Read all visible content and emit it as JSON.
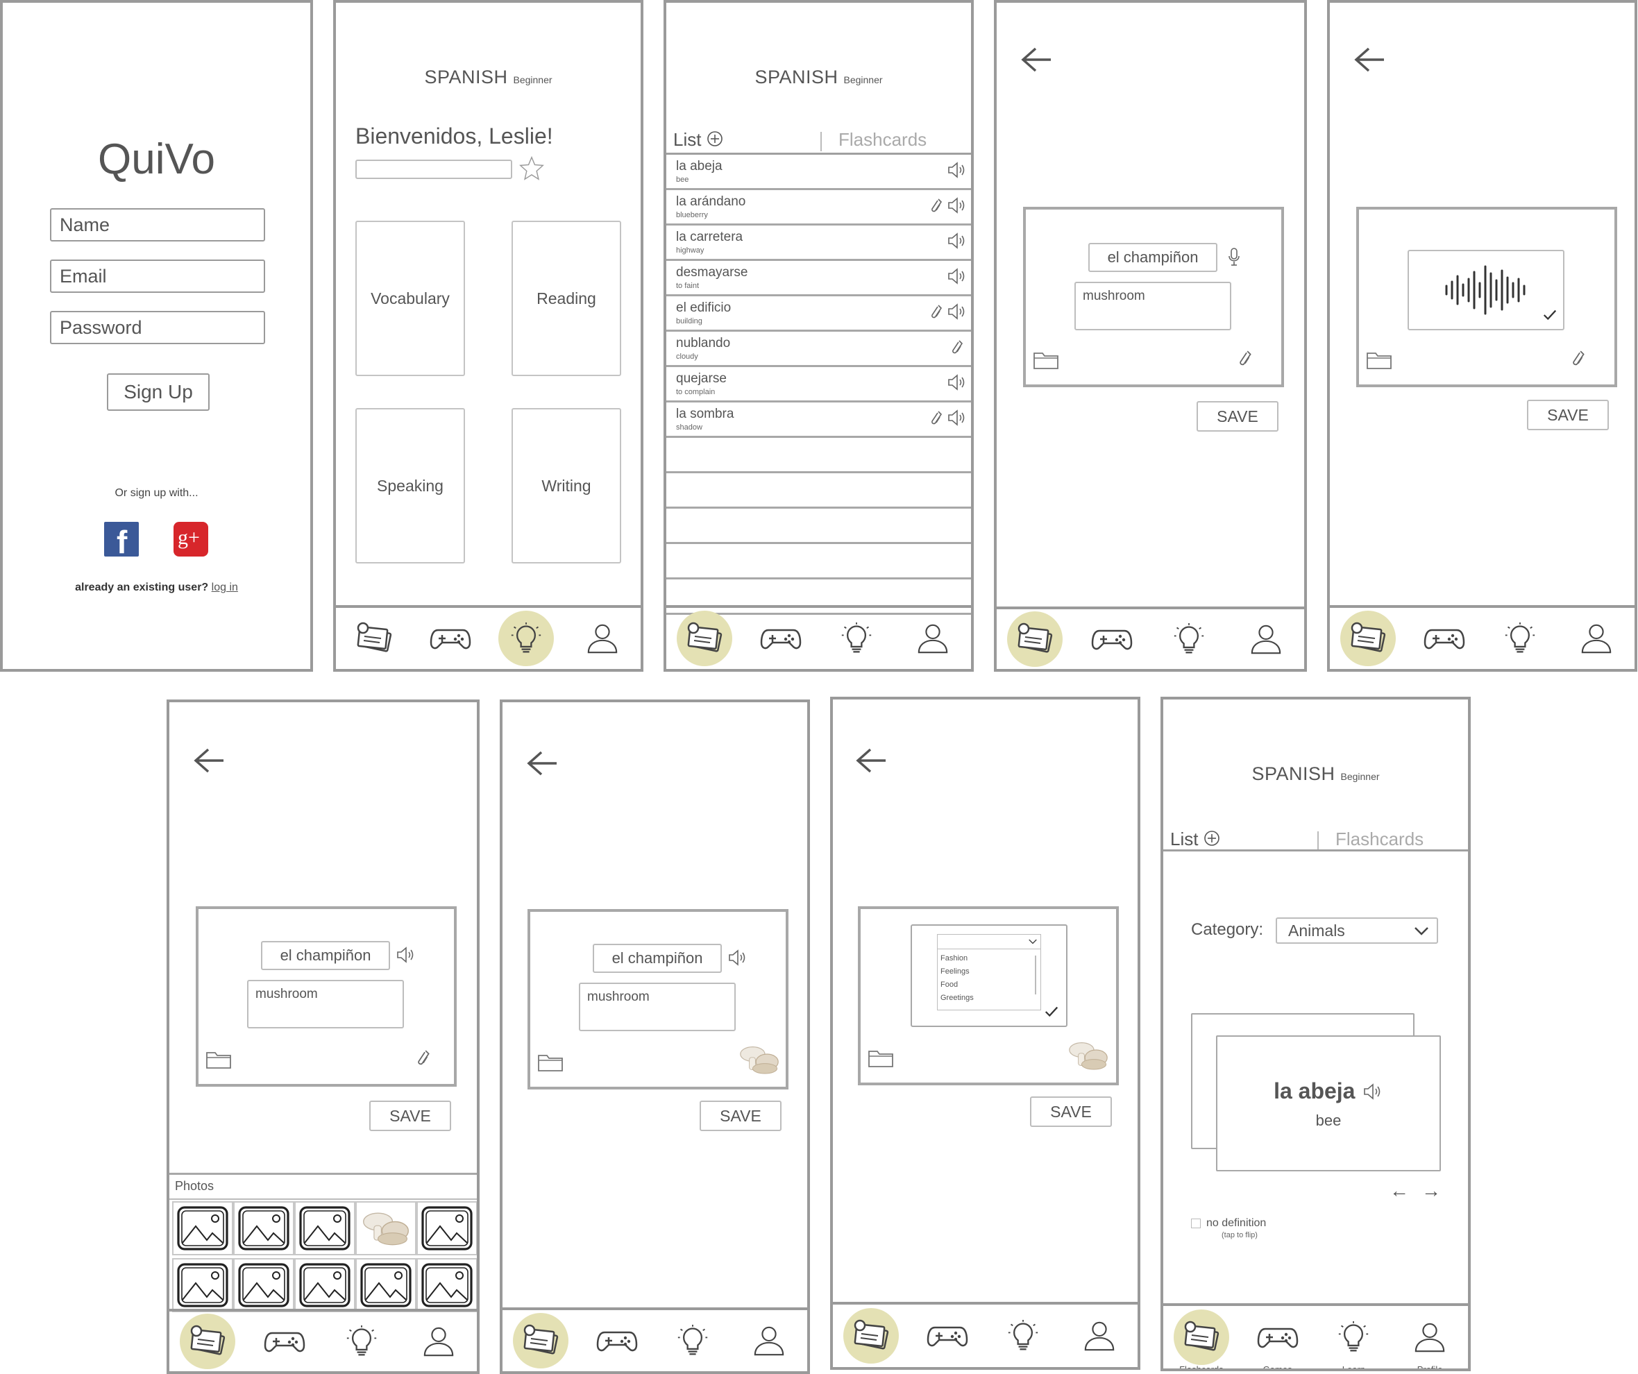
{
  "colors": {
    "accent": "#e4e1b4",
    "border": "#9a9a9a",
    "text": "#555555",
    "facebook": "#3b5998",
    "google": "#d7262b"
  },
  "signup": {
    "logo": "QuiVo",
    "name_placeholder": "Name",
    "email_placeholder": "Email",
    "password_placeholder": "Password",
    "signup_button": "Sign Up",
    "or_text": "Or sign up with...",
    "existing_text": "already an existing user?",
    "login_link": "log in"
  },
  "header": {
    "title": "SPANISH",
    "level": "Beginner"
  },
  "home": {
    "greeting": "Bienvenidos, Leslie!",
    "progress": 0,
    "tiles": [
      "Vocabulary",
      "Reading",
      "Speaking",
      "Writing"
    ]
  },
  "tabs": {
    "list": "List",
    "flashcards": "Flashcards"
  },
  "vocab_list": [
    {
      "word": "la abeja",
      "def": "bee",
      "link": false,
      "audio": true
    },
    {
      "word": "la arándano",
      "def": "blueberry",
      "link": true,
      "audio": true
    },
    {
      "word": "la carretera",
      "def": "highway",
      "link": false,
      "audio": true
    },
    {
      "word": "desmayarse",
      "def": "to faint",
      "link": false,
      "audio": true
    },
    {
      "word": "el edificio",
      "def": "building",
      "link": true,
      "audio": true
    },
    {
      "word": "nublando",
      "def": "cloudy",
      "link": true,
      "audio": false
    },
    {
      "word": "quejarse",
      "def": "to complain",
      "link": false,
      "audio": true
    },
    {
      "word": "la sombra",
      "def": "shadow",
      "link": true,
      "audio": true
    }
  ],
  "editor": {
    "word": "el champiñon",
    "definition": "mushroom",
    "save": "SAVE"
  },
  "photos": {
    "label": "Photos"
  },
  "folder_options": [
    "Fashion",
    "Feelings",
    "Food",
    "Greetings"
  ],
  "flashcards": {
    "category_label": "Category:",
    "category_value": "Animals",
    "card_word": "la abeja",
    "card_def": "bee",
    "no_def_label": "no definition",
    "no_def_hint": "(tap to flip)"
  },
  "nav": {
    "flashcards": "Flashcards",
    "games": "Games",
    "learn": "Learn",
    "profile": "Profile"
  }
}
